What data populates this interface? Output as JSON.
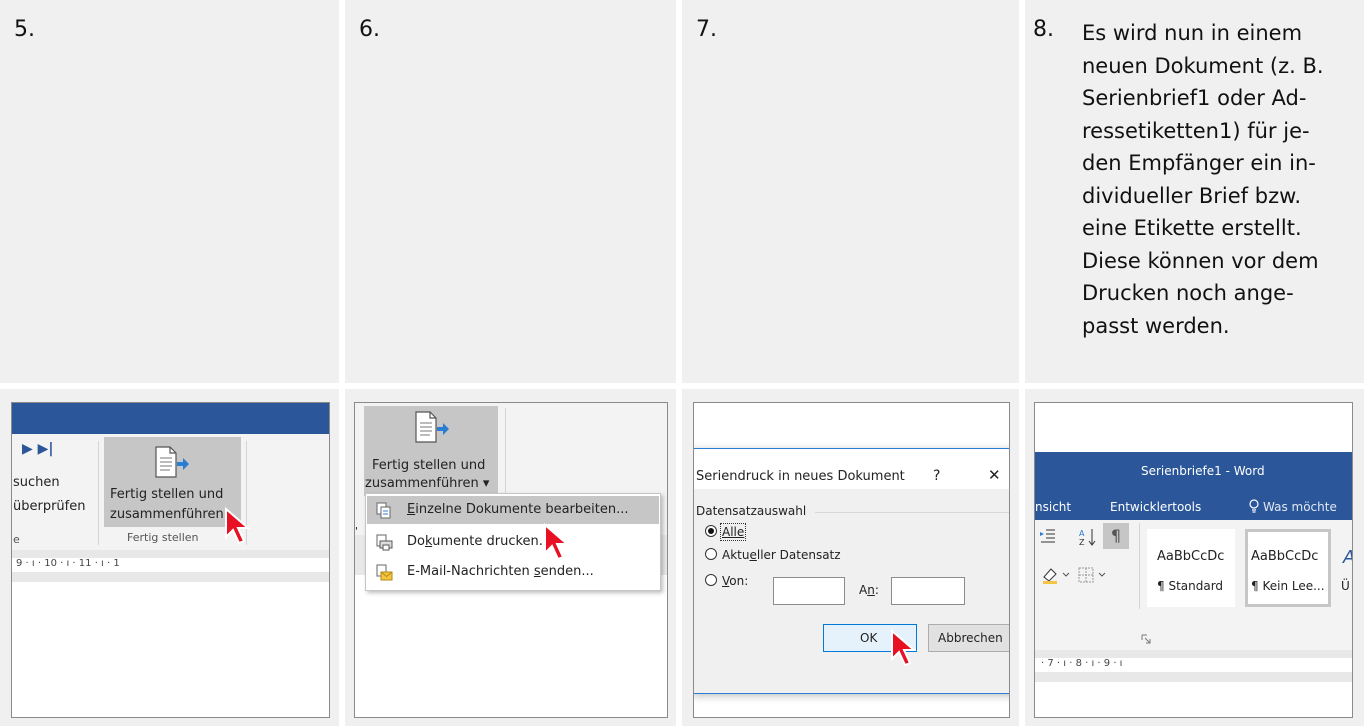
{
  "steps": [
    {
      "number": "5."
    },
    {
      "number": "6."
    },
    {
      "number": "7."
    },
    {
      "number": "8.",
      "text_lines": [
        "Es wird nun in einem",
        "neuen Dokument (z. B.",
        "Serienbrief1 oder Ad-",
        "ressetiketten1) für je-",
        "den Empfänger ein in-",
        "dividueller Brief bzw.",
        "eine Etikette erstellt.",
        "Diese können vor dem",
        "Drucken noch ange-",
        "passt werden."
      ]
    }
  ],
  "shot5": {
    "nav_arrows": "▶ ▶|",
    "find_label": "suchen",
    "check_label": "überprüfen",
    "group_label_partial": "e",
    "finish_label_line1": "Fertig stellen und",
    "finish_label_line2": "zusammenführen",
    "group_label": "Fertig stellen",
    "ruler_text": "9  ·  ı  ·  10  ·  ı  ·  11  ·  ı  ·  1"
  },
  "shot6": {
    "finish_label_line1": "Fertig stellen und",
    "finish_label_line2": "zusammenführen ▾",
    "menu_items": [
      {
        "pre": "",
        "key": "E",
        "post": "inzelne Dokumente bearbeiten..."
      },
      {
        "pre": "Do",
        "key": "k",
        "post": "umente drucken..."
      },
      {
        "pre": "E-Mail-Nachrichten ",
        "key": "s",
        "post": "enden..."
      }
    ]
  },
  "shot7": {
    "dialog_title": "Seriendruck in neues Dokument",
    "help": "?",
    "close": "✕",
    "section_label": "Datensatzauswahl",
    "opt_all": "Alle",
    "opt_current_pre": "Aktu",
    "opt_current_key": "e",
    "opt_current_post": "ller Datensatz",
    "opt_from_key": "V",
    "opt_from_post": "on:",
    "to_pre": "A",
    "to_key": "n",
    "to_post": ":",
    "ok_label": "OK",
    "cancel_label": "Abbrechen"
  },
  "shot8": {
    "window_title": "Serienbriefe1 - Word",
    "tab_view_partial": "nsicht",
    "tab_developer": "Entwicklertools",
    "tell_me": "Was möchte",
    "style1_preview": "AaBbCcDc",
    "style1_name": "¶ Standard",
    "style2_preview": "AaBbCcDc",
    "style2_name": "¶ Kein Lee...",
    "style3_preview": "A",
    "style3_name": "Ü",
    "ruler_text": "·  7  ·  ı  ·  8  ·  ı  ·  9  ·  ı"
  },
  "colors": {
    "word_blue": "#2b579a",
    "cell_bg": "#f0f0f0",
    "selected": "#c6c6c6",
    "cursor_red": "#e81123"
  }
}
